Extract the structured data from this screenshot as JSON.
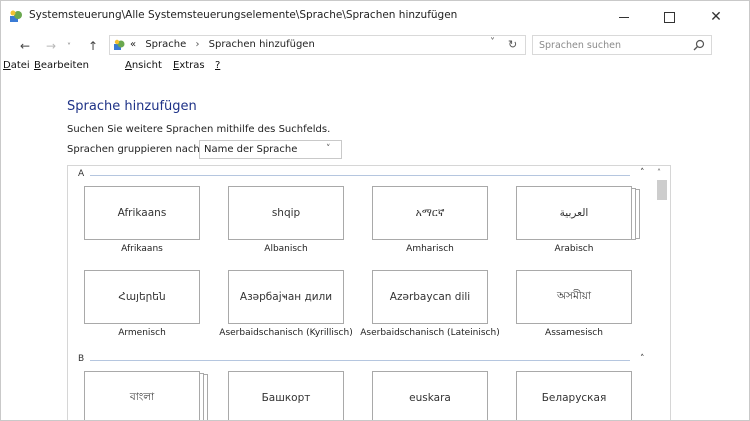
{
  "window": {
    "title": "Systemsteuerung\\Alle Systemsteuerungselemente\\Sprache\\Sprachen hinzufügen",
    "min_glyph": "",
    "max_glyph": "",
    "close_glyph": "✕"
  },
  "addressbar": {
    "back": "←",
    "forward": "→",
    "history": "˅",
    "up": "↑",
    "prefix": "«",
    "crumbs": [
      "Sprache",
      "›",
      "Sprachen hinzufügen"
    ],
    "dropdown": "˅",
    "refresh": "↻",
    "search_placeholder": "Sprachen suchen"
  },
  "menu": [
    {
      "first": "D",
      "rest": "atei"
    },
    {
      "first": "B",
      "rest": "earbeiten"
    },
    {
      "first": "A",
      "rest": "nsicht"
    },
    {
      "first": "E",
      "rest": "xtras",
      "pre": ""
    },
    {
      "first": "?",
      "rest": ""
    }
  ],
  "content": {
    "heading": "Sprache hinzufügen",
    "hint": "Suchen Sie weitere Sprachen mithilfe des Suchfelds.",
    "group_label": "Sprachen gruppieren nach:",
    "group_value": "Name der Sprache",
    "group_chevron": "˅"
  },
  "sections": [
    {
      "letter": "A",
      "collapse": "˄",
      "tiles": [
        {
          "native": "Afrikaans",
          "label": "Afrikaans",
          "stacked": false
        },
        {
          "native": "shqip",
          "label": "Albanisch",
          "stacked": false
        },
        {
          "native": "አማርኛ",
          "label": "Amharisch",
          "stacked": false
        },
        {
          "native": "العربية",
          "label": "Arabisch",
          "stacked": true
        },
        {
          "native": "Հայերեն",
          "label": "Armenisch",
          "stacked": false
        },
        {
          "native": "Азәрбајҹан дили",
          "label": "Aserbaidschanisch (Kyrillisch)",
          "stacked": false
        },
        {
          "native": "Azərbaycan dili",
          "label": "Aserbaidschanisch (Lateinisch)",
          "stacked": false
        },
        {
          "native": "অসমীয়া",
          "label": "Assamesisch",
          "stacked": false
        }
      ]
    },
    {
      "letter": "B",
      "collapse": "˄",
      "tiles": [
        {
          "native": "বাংলা",
          "label": "",
          "stacked": true
        },
        {
          "native": "Башкорт",
          "label": "",
          "stacked": false
        },
        {
          "native": "euskara",
          "label": "",
          "stacked": false
        },
        {
          "native": "Беларуская",
          "label": "",
          "stacked": false
        }
      ]
    }
  ],
  "scroll": {
    "up": "˄"
  }
}
